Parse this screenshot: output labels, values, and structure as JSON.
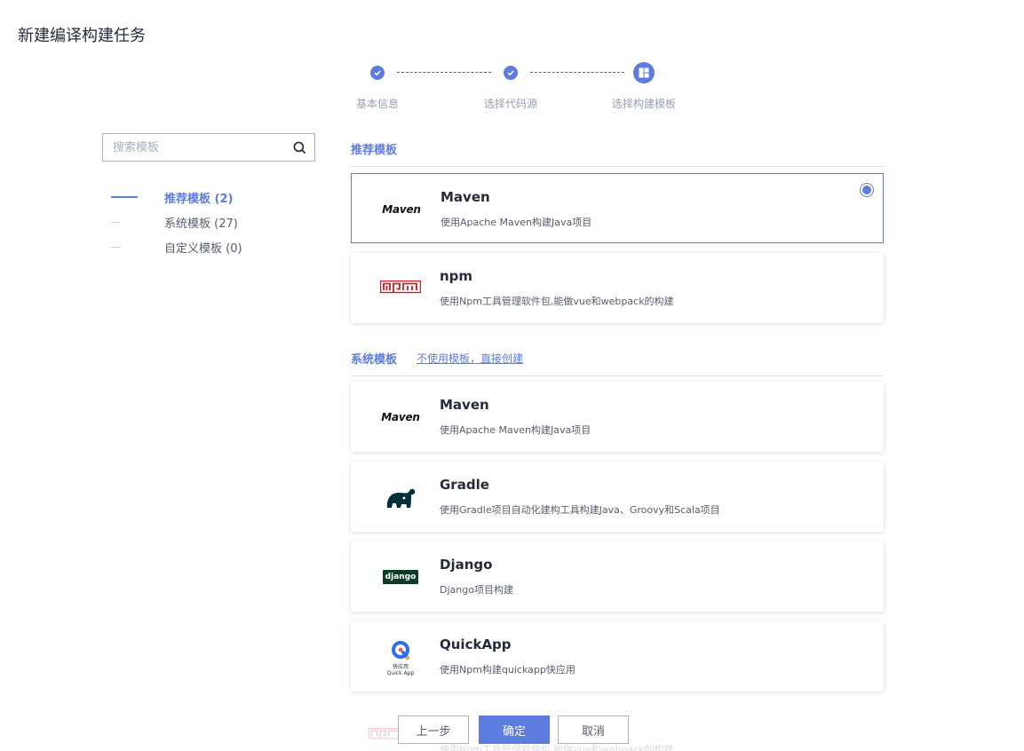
{
  "page": {
    "title": "新建编译构建任务"
  },
  "steps": [
    {
      "label": "基本信息",
      "state": "done"
    },
    {
      "label": "选择代码源",
      "state": "done"
    },
    {
      "label": "选择构建模板",
      "state": "current"
    }
  ],
  "search": {
    "placeholder": "搜索模板",
    "value": ""
  },
  "categories": [
    {
      "label": "推荐模板 (2)",
      "active": true
    },
    {
      "label": "系统模板 (27)",
      "active": false
    },
    {
      "label": "自定义模板 (0)",
      "active": false
    }
  ],
  "recommended": {
    "title": "推荐模板",
    "items": [
      {
        "name": "Maven",
        "desc": "使用Apache Maven构建Java项目",
        "logo": "maven-logo",
        "selected": true
      },
      {
        "name": "npm",
        "desc": "使用Npm工具管理软件包,能做vue和webpack的构建",
        "logo": "npm-logo",
        "selected": false
      }
    ]
  },
  "system": {
    "title": "系统模板",
    "link": "不使用模板，直接创建",
    "items": [
      {
        "name": "Maven",
        "desc": "使用Apache Maven构建Java项目",
        "logo": "maven-logo"
      },
      {
        "name": "Gradle",
        "desc": "使用Gradle项目自动化建构工具构建Java、Groovy和Scala项目",
        "logo": "gradle-elephant-logo"
      },
      {
        "name": "Django",
        "desc": "Django项目构建",
        "logo": "django-logo"
      },
      {
        "name": "QuickApp",
        "desc": "使用Npm构建quickapp快应用",
        "logo": "quickapp-logo"
      }
    ],
    "partial_item": {
      "desc": "使用Npm工具管理软件包,能做vue和webpack的构建"
    }
  },
  "logos": {
    "maven_text": "Maven",
    "npm_text": "npm",
    "django_text": "django",
    "quickapp_caption_cn": "快应用",
    "quickapp_caption_en": "Quick App"
  },
  "buttons": {
    "prev": "上一步",
    "ok": "确定",
    "cancel": "取消"
  },
  "colors": {
    "accent": "#5e7ce0",
    "text": "#252b3a",
    "muted": "#575d6c",
    "npm": "#c12127",
    "django": "#0c3c26",
    "gradle": "#02303a"
  }
}
